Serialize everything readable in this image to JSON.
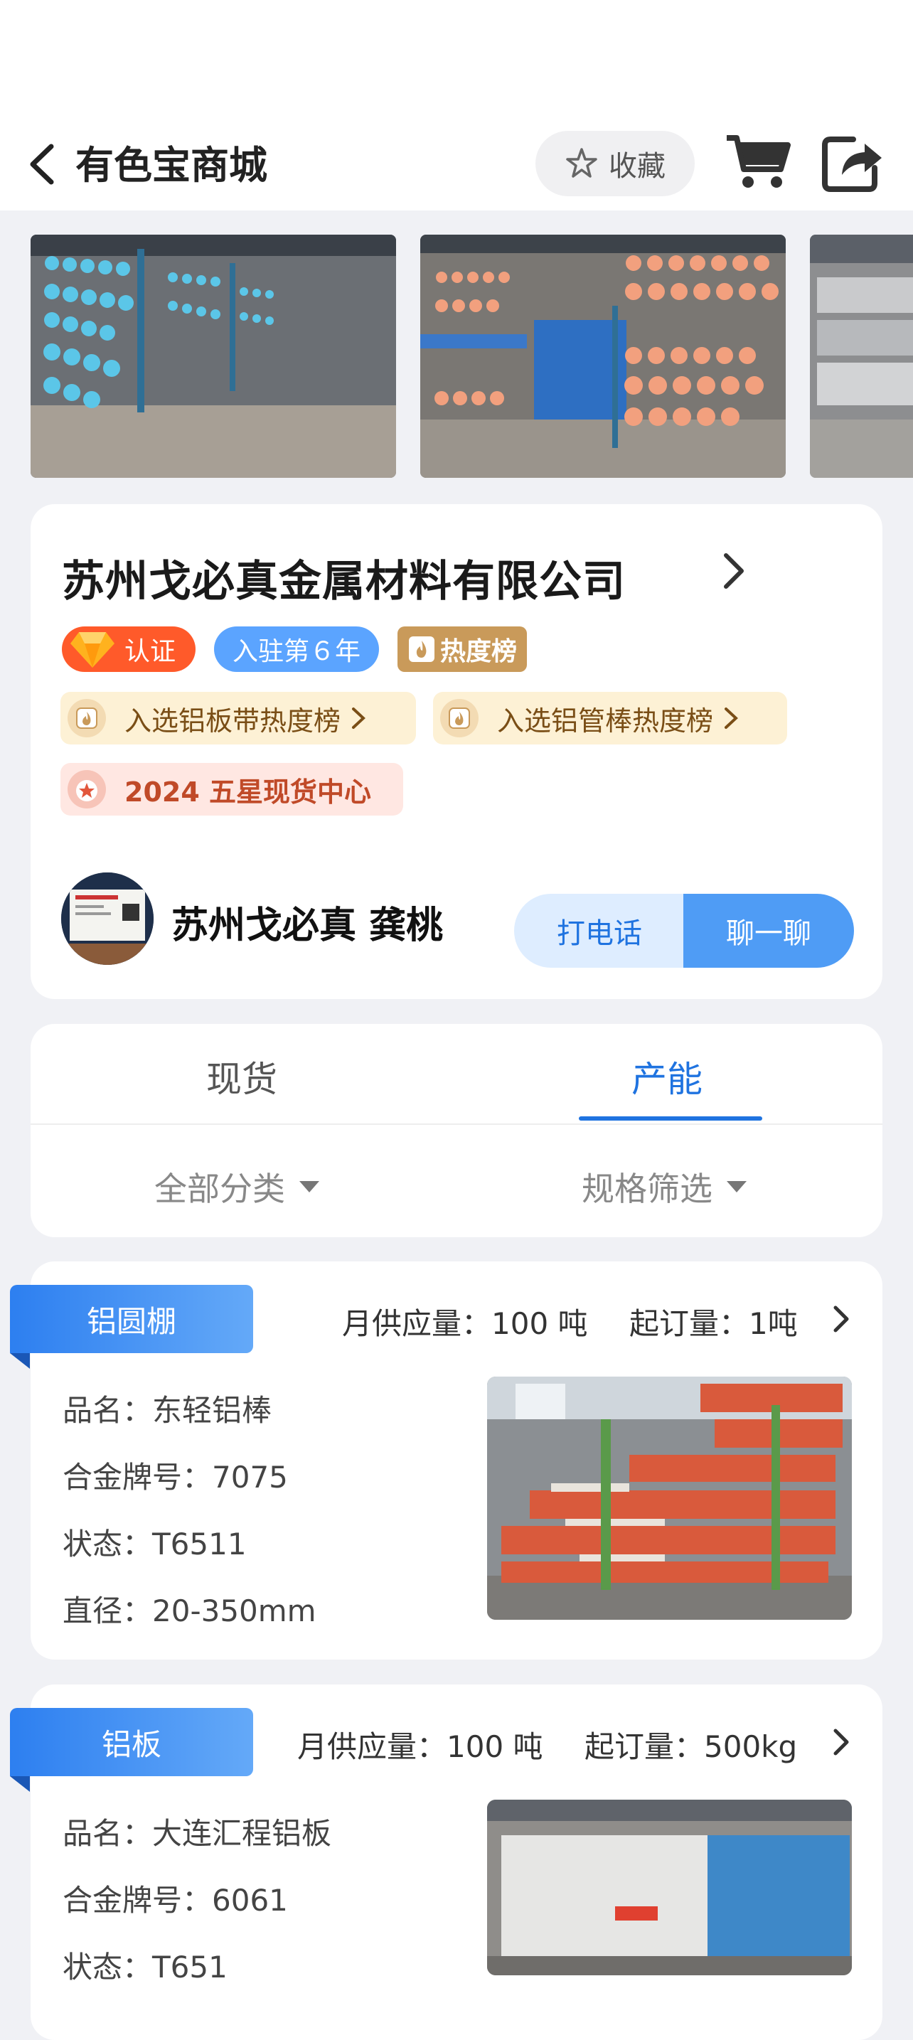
{
  "header": {
    "title": "有色宝商城",
    "favorite_label": "收藏",
    "icons": [
      "back-chevron-icon",
      "star-icon",
      "cart-icon",
      "share-icon"
    ]
  },
  "photos": [
    "aluminum-bars-photo",
    "aluminum-rods-photo",
    "aluminum-sheets-photo"
  ],
  "company": {
    "name": "苏州戈必真金属材料有限公司",
    "badges": {
      "certified": "认证",
      "years": "入驻第６年",
      "hot_rank": "热度榜"
    },
    "rank_pills": [
      "入选铝板带热度榜",
      "入选铝管棒热度榜",
      "2024 五星现货中心"
    ],
    "contact_name": "苏州戈必真 龚桃",
    "call_label": "打电话",
    "chat_label": "聊一聊"
  },
  "tabs": {
    "items": [
      "现货",
      "产能"
    ],
    "active": "产能",
    "filters": [
      "全部分类",
      "规格筛选"
    ]
  },
  "products": [
    {
      "category": "铝圆棚",
      "monthly_supply": "月供应量：100 吨",
      "min_order": "起订量：1吨",
      "specs": [
        "品名：东轻铝棒",
        "合金牌号：7075",
        "状态：T6511",
        "直径：20-350mm"
      ]
    },
    {
      "category": "铝板",
      "monthly_supply": "月供应量：100 吨",
      "min_order": "起订量：500kg",
      "specs": [
        "品名：大连汇程铝板",
        "合金牌号：6061",
        "状态：T651"
      ]
    }
  ],
  "colors": {
    "accent_blue": "#1f73e0",
    "badge_orange": "#ff5a2a",
    "badge_blue": "#5ba4ff",
    "hot_gold": "#c99a5a",
    "page_bg": "#f0f1f5"
  }
}
